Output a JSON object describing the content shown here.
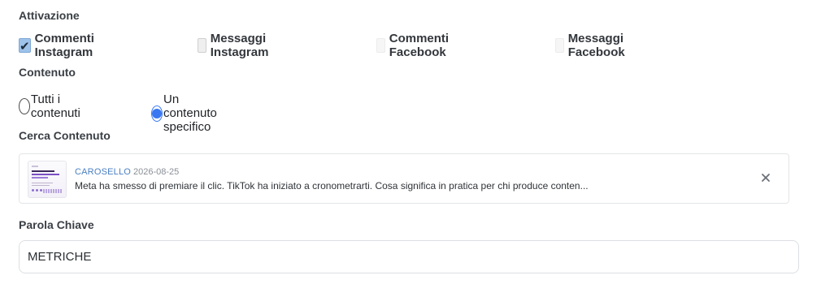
{
  "activation": {
    "title": "Attivazione",
    "options": [
      {
        "label": "Commenti Instagram",
        "checked": true
      },
      {
        "label": "Messaggi Instagram",
        "checked": false
      },
      {
        "label": "Commenti Facebook",
        "checked": false
      },
      {
        "label": "Messaggi Facebook",
        "checked": false
      }
    ]
  },
  "content": {
    "title": "Contenuto",
    "options": [
      {
        "label": "Tutti i contenuti",
        "selected": false
      },
      {
        "label": "Un contenuto specifico",
        "selected": true
      }
    ],
    "accent_color": "#3a78f2"
  },
  "search_content": {
    "title": "Cerca Contenuto",
    "selected_item": {
      "type": "CAROSELLO",
      "date": "2026-08-25",
      "description": "Meta ha smesso di premiare il clic. TikTok ha iniziato a cronometrarti. Cosa significa in pratica per chi produce conten...",
      "remove_icon": "close-icon"
    }
  },
  "keyword": {
    "title": "Parola Chiave",
    "value": "METRICHE"
  }
}
